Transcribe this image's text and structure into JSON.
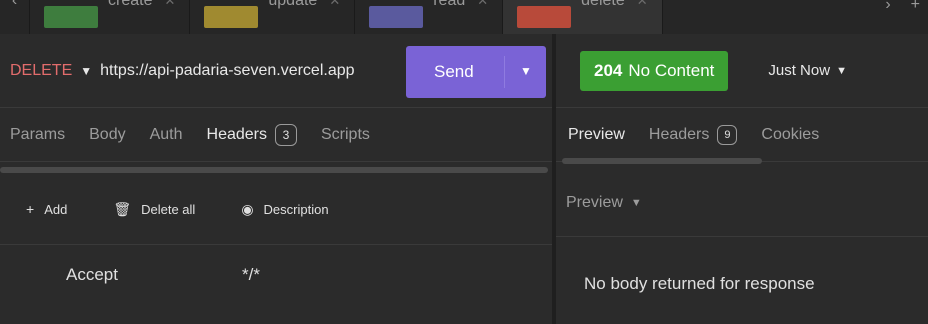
{
  "tabs": [
    {
      "label": "create",
      "color": "#3e7d3e"
    },
    {
      "label": "update",
      "color": "#a08a30"
    },
    {
      "label": "read",
      "color": "#5a5a9e"
    },
    {
      "label": "delete",
      "color": "#b84a3a"
    }
  ],
  "request": {
    "method": "DELETE",
    "method_color": "#e26c6c",
    "url": "https://api-padaria-seven.vercel.app",
    "send_label": "Send",
    "send_color": "#7a63d6",
    "tabs": [
      {
        "label": "Params"
      },
      {
        "label": "Body"
      },
      {
        "label": "Auth"
      },
      {
        "label": "Headers",
        "count": "3",
        "active": true
      },
      {
        "label": "Scripts"
      }
    ],
    "actions": {
      "add": "Add",
      "delete_all": "Delete all",
      "description": "Description"
    },
    "headers": [
      {
        "key": "Accept",
        "value": "*/*"
      }
    ]
  },
  "response": {
    "status_code": "204",
    "status_text": "No Content",
    "status_color": "#3b9f33",
    "time": "Just Now",
    "tabs": [
      {
        "label": "Preview",
        "active": true
      },
      {
        "label": "Headers",
        "count": "9"
      },
      {
        "label": "Cookies"
      }
    ],
    "preview_mode": "Preview",
    "empty_message": "No body returned for response"
  }
}
